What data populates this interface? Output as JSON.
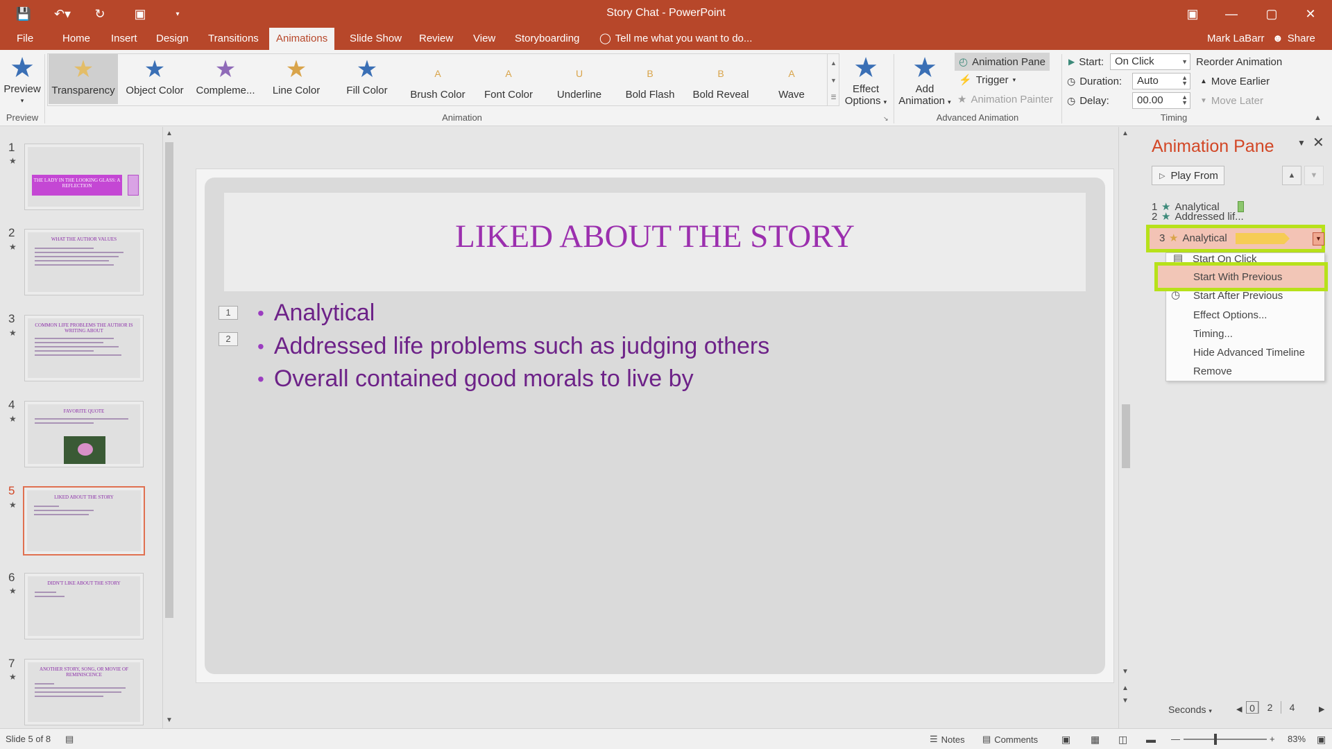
{
  "window": {
    "title": "Story Chat - PowerPoint",
    "user": "Mark LaBarr",
    "share": "Share",
    "tell_me": "Tell me what you want to do..."
  },
  "tabs": [
    "File",
    "Home",
    "Insert",
    "Design",
    "Transitions",
    "Animations",
    "Slide Show",
    "Review",
    "View",
    "Storyboarding"
  ],
  "ribbon": {
    "preview": {
      "label": "Preview",
      "group": "Preview"
    },
    "animations": [
      "Transparency",
      "Object Color",
      "Compleme...",
      "Line Color",
      "Fill Color",
      "Brush Color",
      "Font Color",
      "Underline",
      "Bold Flash",
      "Bold Reveal",
      "Wave"
    ],
    "anim_letters": [
      "",
      "",
      "",
      "",
      "",
      "A",
      "A",
      "U",
      "B",
      "B",
      "A"
    ],
    "animation_group": "Animation",
    "effect_options": {
      "line1": "Effect",
      "line2": "Options"
    },
    "add_animation": {
      "line1": "Add",
      "line2": "Animation"
    },
    "advanced": {
      "group": "Advanced Animation",
      "animation_pane": "Animation Pane",
      "trigger": "Trigger",
      "animation_painter": "Animation Painter"
    },
    "timing": {
      "group": "Timing",
      "start_label": "Start:",
      "start_value": "On Click",
      "duration_label": "Duration:",
      "duration_value": "Auto",
      "delay_label": "Delay:",
      "delay_value": "00.00",
      "reorder": "Reorder Animation",
      "move_earlier": "Move Earlier",
      "move_later": "Move Later"
    }
  },
  "slides": [
    {
      "num": "1",
      "title": "THE LADY IN THE LOOKING GLASS: A REFLECTION"
    },
    {
      "num": "2",
      "title": "WHAT THE AUTHOR VALUES"
    },
    {
      "num": "3",
      "title": "COMMON LIFE PROBLEMS THE AUTHOR IS WRITING ABOUT"
    },
    {
      "num": "4",
      "title": "FAVORITE QUOTE"
    },
    {
      "num": "5",
      "title": "LIKED ABOUT THE STORY"
    },
    {
      "num": "6",
      "title": "DIDN'T LIKE ABOUT THE STORY"
    },
    {
      "num": "7",
      "title": "ANOTHER STORY, SONG, OR MOVIE OF REMINISCENCE"
    }
  ],
  "slide": {
    "title": "LIKED ABOUT THE STORY",
    "bullets": [
      "Analytical",
      "Addressed life problems such as judging others",
      "Overall contained good morals to live by"
    ],
    "tags": [
      "1",
      "2"
    ]
  },
  "pane": {
    "title": "Animation Pane",
    "play_from": "Play From",
    "items": [
      {
        "idx": "1",
        "name": "Analytical"
      },
      {
        "idx": "2",
        "name": "Addressed lif..."
      },
      {
        "idx": "3",
        "name": "Analytical"
      }
    ],
    "menu": [
      "Start On Click",
      "Start With Previous",
      "Start After Previous",
      "Effect Options...",
      "Timing...",
      "Hide Advanced Timeline",
      "Remove"
    ],
    "seconds": "Seconds",
    "timeline": [
      "0",
      "2",
      "4"
    ]
  },
  "status": {
    "slide_of": "Slide 5 of 8",
    "notes": "Notes",
    "comments": "Comments",
    "zoom": "83%"
  },
  "colors": {
    "accent": "#b7472a",
    "highlight": "#b7e11a",
    "title_purple": "#9b2fae"
  }
}
